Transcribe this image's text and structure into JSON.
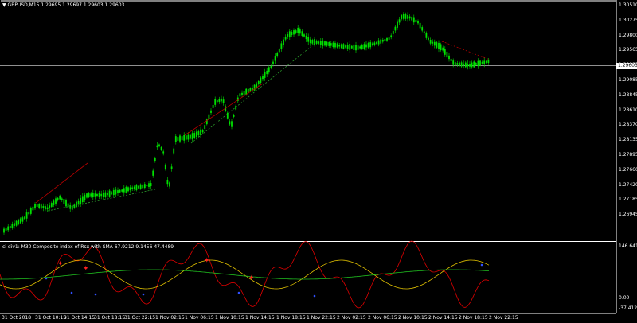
{
  "main_chart": {
    "symbol_header": "GBPUSD,M15  1.29695 1.29697 1.29603 1.29603",
    "current_price": "1.29603",
    "price_axis": [
      "1.30510",
      "1.30275",
      "1.29800",
      "1.29565",
      "1.29325",
      "1.29085",
      "1.28845",
      "1.28610",
      "1.28370",
      "1.28135",
      "1.27895",
      "1.27660",
      "1.27420",
      "1.27185",
      "1.26945"
    ],
    "colors": {
      "candle": "#00e000",
      "trend_red": "#b40000",
      "trend_green": "#2a9a2a",
      "background": "#000000",
      "axis": "#ffffff"
    }
  },
  "indicator": {
    "header": "ci div1: M30  Composite index of Rsx with SMA 67.9212 9.1456 47.4489",
    "axis": [
      "146.641",
      "0.00",
      "-37.4121"
    ],
    "colors": {
      "composite": "#e00000",
      "sma_fast": "#e0c000",
      "sma_slow": "#20c020",
      "arrow_red": "#ff2020",
      "dot_blue": "#3050ff"
    }
  },
  "time_axis": [
    "31 Oct 2018",
    "31 Oct 10:15",
    "31 Oct 14:15",
    "31 Oct 18:15",
    "31 Oct 22:15",
    "1 Nov 02:15",
    "1 Nov 06:15",
    "1 Nov 10:15",
    "1 Nov 14:15",
    "1 Nov 18:15",
    "1 Nov 22:15",
    "2 Nov 02:15",
    "2 Nov 06:15",
    "2 Nov 10:15",
    "2 Nov 14:15",
    "2 Nov 18:15",
    "2 Nov 22:15"
  ]
}
